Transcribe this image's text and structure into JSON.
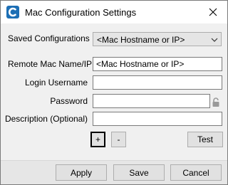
{
  "window": {
    "title": "Mac Configuration Settings",
    "close_icon": "close-icon",
    "app_icon": "app-logo-icon",
    "accent_color": "#1d6fb5"
  },
  "form": {
    "saved_configurations": {
      "label": "Saved Configurations",
      "selected": "<Mac Hostname or IP>"
    },
    "remote_mac": {
      "label": "Remote Mac Name/IP",
      "placeholder": "<Mac Hostname or IP>"
    },
    "login_username": {
      "label": "Login Username",
      "value": ""
    },
    "password": {
      "label": "Password",
      "value": "",
      "icon": "lock-icon"
    },
    "description": {
      "label": "Description (Optional)",
      "value": ""
    }
  },
  "buttons": {
    "add": "+",
    "remove": "-",
    "test": "Test",
    "apply": "Apply",
    "save": "Save",
    "cancel": "Cancel"
  }
}
